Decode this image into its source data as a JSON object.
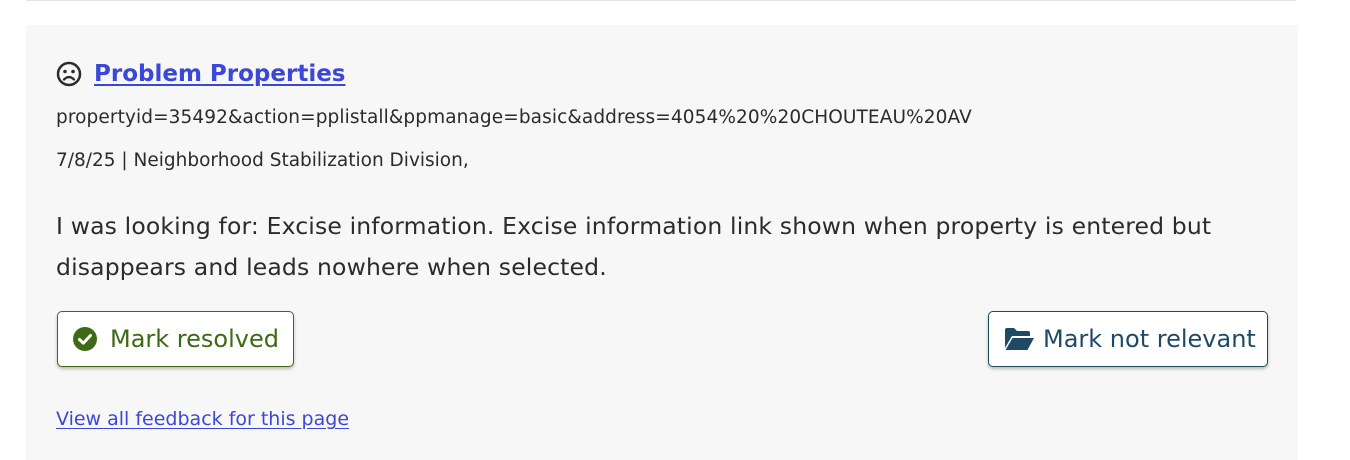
{
  "feedback": {
    "title": "Problem Properties",
    "url_params": "propertyid=35492&action=pplistall&ppmanage=basic&address=4054%20%20CHOUTEAU%20AV",
    "meta": "7/8/25 | Neighborhood Stabilization Division,",
    "comment": "I was looking for: Excise information. Excise information link shown when property is entered but disappears and leads nowhere when selected.",
    "mood_icon": "sad-face-icon"
  },
  "actions": {
    "resolved_label": "Mark resolved",
    "resolved_icon": "check-circle-icon",
    "not_relevant_label": "Mark not relevant",
    "not_relevant_icon": "folder-open-icon"
  },
  "footer": {
    "view_all_label": "View all feedback for this page"
  },
  "colors": {
    "link": "#3b47d6",
    "resolved": "#3d6a14",
    "not_relevant": "#1f4a66",
    "card_bg": "#f7f7f7"
  }
}
